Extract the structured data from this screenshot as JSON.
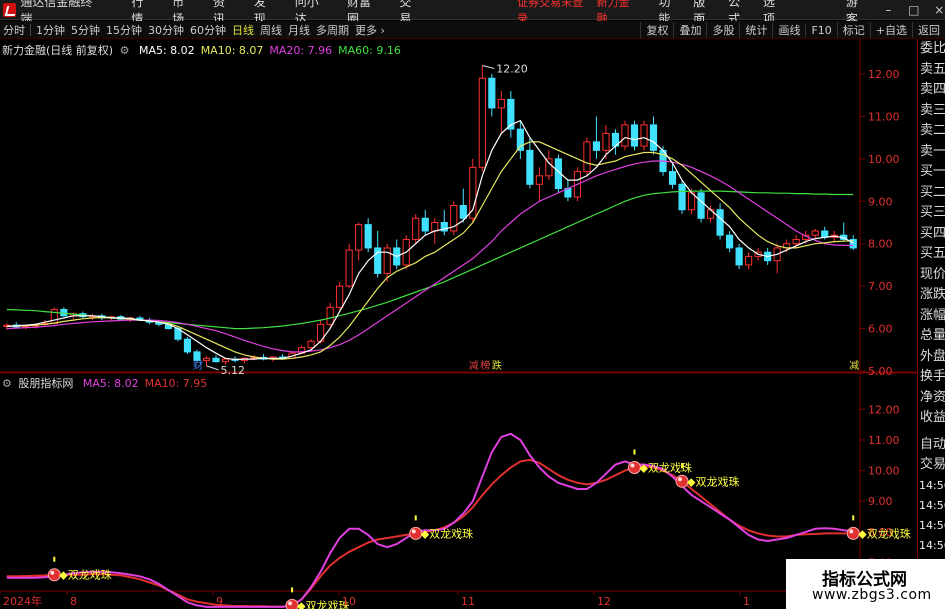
{
  "menubar": {
    "app_name": "通达信金融终端",
    "menus": [
      "行情",
      "市场",
      "资讯",
      "发现",
      "问小达",
      "财富圈",
      "交易"
    ],
    "warning": "证券交易未登录",
    "product": "新力金融",
    "right_menus": [
      "功能",
      "版面",
      "公式",
      "选项"
    ],
    "guest": "游客",
    "window_buttons": [
      "–",
      "□",
      "×"
    ]
  },
  "toolbar": {
    "periods": [
      "分时",
      "1分钟",
      "5分钟",
      "15分钟",
      "30分钟",
      "60分钟",
      "日线",
      "周线",
      "月线",
      "多周期",
      "更多"
    ],
    "active_period": "日线",
    "right_buttons": [
      "复权",
      "叠加",
      "多股",
      "统计",
      "画线",
      "F10",
      "标记",
      "+自选",
      "返回"
    ]
  },
  "main_chart": {
    "title": "新力金融(日线 前复权)",
    "ma_labels": [
      {
        "text": "MA5: 8.02",
        "color": "#ffffff"
      },
      {
        "text": "MA10: 8.07",
        "color": "#e8e860"
      },
      {
        "text": "MA20: 7.96",
        "color": "#e040e0"
      },
      {
        "text": "MA60: 9.16",
        "color": "#40e040"
      }
    ],
    "y_ticks": [
      "12.00",
      "11.00",
      "10.00",
      "9.00",
      "8.00",
      "7.00",
      "6.00",
      "5.00"
    ],
    "high_label": "12.20",
    "low_label": "5.12",
    "event_tags": [
      {
        "text": "财",
        "color": "#4a8cff"
      },
      {
        "text": "减",
        "color": "#e04040"
      },
      {
        "text": "榜",
        "color": "#e04040"
      },
      {
        "text": "跌",
        "color": "#e0e040"
      },
      {
        "text": "减",
        "color": "#e0e040"
      }
    ]
  },
  "sub_chart": {
    "title": "股朋指标网",
    "ma_labels": [
      {
        "text": "MA5: 8.02",
        "color": "#e040e0"
      },
      {
        "text": "MA10: 7.95",
        "color": "#e03030"
      }
    ],
    "y_ticks": [
      "12.00",
      "11.00",
      "10.00",
      "9.00",
      "8.00",
      "7.00"
    ],
    "signal_label": "双龙戏珠",
    "colors": {
      "ma5": "#e040e0",
      "ma10": "#e03030",
      "marker": "#e03030",
      "text": "#ffff40"
    }
  },
  "x_axis": {
    "labels": [
      "2024年",
      "8",
      "9",
      "10",
      "11",
      "12",
      "1"
    ]
  },
  "side_panel": {
    "items": [
      "委比",
      "卖五",
      "卖四",
      "卖三",
      "卖二",
      "卖一",
      "买一",
      "买二",
      "买三",
      "买四",
      "买五",
      "现价",
      "涨跌",
      "涨幅",
      "总量",
      "外盘",
      "换手",
      "净资",
      "收益"
    ],
    "items2": [
      "自动",
      "交易"
    ],
    "times": [
      "14:56",
      "14:56",
      "14:56",
      "14:56",
      "14:56",
      "14:56",
      "14:56",
      "14:56"
    ]
  },
  "watermark": {
    "title": "指标公式网",
    "url": "www.zbgs3.com"
  },
  "chart_data": [
    {
      "type": "candlestick",
      "title": "新力金融(日线 前复权)",
      "ylim": [
        5.0,
        12.4
      ],
      "up_color": "#ff3030",
      "down_color": "#40e0ff",
      "candles": [
        [
          6.05,
          6.12,
          5.98,
          6.08
        ],
        [
          6.08,
          6.15,
          6.0,
          6.04
        ],
        [
          6.04,
          6.1,
          5.98,
          6.06
        ],
        [
          6.06,
          6.12,
          6.0,
          6.1
        ],
        [
          6.1,
          6.2,
          6.05,
          6.12
        ],
        [
          6.12,
          6.5,
          6.1,
          6.45
        ],
        [
          6.45,
          6.5,
          6.28,
          6.3
        ],
        [
          6.3,
          6.38,
          6.22,
          6.35
        ],
        [
          6.35,
          6.4,
          6.25,
          6.28
        ],
        [
          6.28,
          6.35,
          6.2,
          6.3
        ],
        [
          6.3,
          6.35,
          6.2,
          6.25
        ],
        [
          6.25,
          6.3,
          6.18,
          6.28
        ],
        [
          6.28,
          6.32,
          6.2,
          6.22
        ],
        [
          6.22,
          6.28,
          6.15,
          6.25
        ],
        [
          6.25,
          6.3,
          6.18,
          6.2
        ],
        [
          6.2,
          6.25,
          6.1,
          6.15
        ],
        [
          6.15,
          6.2,
          6.05,
          6.1
        ],
        [
          6.1,
          6.15,
          5.98,
          6.0
        ],
        [
          6.0,
          6.05,
          5.7,
          5.75
        ],
        [
          5.75,
          5.8,
          5.4,
          5.45
        ],
        [
          5.45,
          5.5,
          5.2,
          5.25
        ],
        [
          5.25,
          5.35,
          5.12,
          5.3
        ],
        [
          5.3,
          5.38,
          5.2,
          5.22
        ],
        [
          5.22,
          5.3,
          5.15,
          5.28
        ],
        [
          5.28,
          5.35,
          5.2,
          5.25
        ],
        [
          5.25,
          5.32,
          5.18,
          5.3
        ],
        [
          5.3,
          5.38,
          5.25,
          5.32
        ],
        [
          5.32,
          5.4,
          5.25,
          5.28
        ],
        [
          5.28,
          5.35,
          5.22,
          5.33
        ],
        [
          5.33,
          5.4,
          5.28,
          5.3
        ],
        [
          5.3,
          5.45,
          5.28,
          5.42
        ],
        [
          5.42,
          5.6,
          5.4,
          5.55
        ],
        [
          5.55,
          5.75,
          5.5,
          5.7
        ],
        [
          5.7,
          6.2,
          5.65,
          6.1
        ],
        [
          6.1,
          6.6,
          6.05,
          6.5
        ],
        [
          6.5,
          7.1,
          6.45,
          7.0
        ],
        [
          7.0,
          8.0,
          6.95,
          7.85
        ],
        [
          7.85,
          8.5,
          7.6,
          8.45
        ],
        [
          8.45,
          8.6,
          7.8,
          7.9
        ],
        [
          7.9,
          8.3,
          7.2,
          7.3
        ],
        [
          7.3,
          8.0,
          7.1,
          7.9
        ],
        [
          7.9,
          8.1,
          7.4,
          7.5
        ],
        [
          7.5,
          8.2,
          7.4,
          8.1
        ],
        [
          8.1,
          8.7,
          8.0,
          8.6
        ],
        [
          8.6,
          8.8,
          8.2,
          8.3
        ],
        [
          8.3,
          8.6,
          8.0,
          8.5
        ],
        [
          8.5,
          8.8,
          8.2,
          8.3
        ],
        [
          8.3,
          9.0,
          8.2,
          8.9
        ],
        [
          8.9,
          9.3,
          8.5,
          8.6
        ],
        [
          8.6,
          10.0,
          8.5,
          9.8
        ],
        [
          9.8,
          12.2,
          9.7,
          11.9
        ],
        [
          11.9,
          12.0,
          11.0,
          11.2
        ],
        [
          11.2,
          11.6,
          10.6,
          11.4
        ],
        [
          11.4,
          11.6,
          10.5,
          10.7
        ],
        [
          10.7,
          10.9,
          10.0,
          10.2
        ],
        [
          10.2,
          10.5,
          9.3,
          9.4
        ],
        [
          9.4,
          9.8,
          9.0,
          9.6
        ],
        [
          9.6,
          10.2,
          9.5,
          10.0
        ],
        [
          10.0,
          10.1,
          9.2,
          9.3
        ],
        [
          9.3,
          9.5,
          9.0,
          9.1
        ],
        [
          9.1,
          9.8,
          9.0,
          9.7
        ],
        [
          9.7,
          10.5,
          9.6,
          10.4
        ],
        [
          10.4,
          11.0,
          10.0,
          10.2
        ],
        [
          10.2,
          10.8,
          10.0,
          10.6
        ],
        [
          10.6,
          10.7,
          10.1,
          10.3
        ],
        [
          10.3,
          10.9,
          10.2,
          10.8
        ],
        [
          10.8,
          10.9,
          10.2,
          10.3
        ],
        [
          10.3,
          10.9,
          10.2,
          10.8
        ],
        [
          10.8,
          11.0,
          10.1,
          10.2
        ],
        [
          10.2,
          10.3,
          9.6,
          9.7
        ],
        [
          9.7,
          9.9,
          9.3,
          9.4
        ],
        [
          9.4,
          9.5,
          8.7,
          8.8
        ],
        [
          8.8,
          9.3,
          8.7,
          9.2
        ],
        [
          9.2,
          9.3,
          8.5,
          8.6
        ],
        [
          8.6,
          8.9,
          8.5,
          8.8
        ],
        [
          8.8,
          8.95,
          8.1,
          8.2
        ],
        [
          8.2,
          8.3,
          7.8,
          7.9
        ],
        [
          7.9,
          8.0,
          7.4,
          7.5
        ],
        [
          7.5,
          7.8,
          7.4,
          7.7
        ],
        [
          7.7,
          7.9,
          7.6,
          7.8
        ],
        [
          7.8,
          7.9,
          7.5,
          7.6
        ],
        [
          7.6,
          8.0,
          7.3,
          7.9
        ],
        [
          7.9,
          8.1,
          7.8,
          8.0
        ],
        [
          8.0,
          8.2,
          7.9,
          8.1
        ],
        [
          8.1,
          8.3,
          8.0,
          8.2
        ],
        [
          8.2,
          8.35,
          8.1,
          8.3
        ],
        [
          8.3,
          8.4,
          8.1,
          8.15
        ],
        [
          8.15,
          8.3,
          8.05,
          8.2
        ],
        [
          8.2,
          8.5,
          8.05,
          8.1
        ],
        [
          8.1,
          8.2,
          7.85,
          7.9
        ]
      ],
      "ma5": [
        6.05,
        6.07,
        6.08,
        6.1,
        6.15,
        6.2,
        6.25,
        6.3,
        6.3,
        6.3,
        6.28,
        6.25,
        6.25,
        6.24,
        6.2,
        6.18,
        6.15,
        6.1,
        6.0,
        5.85,
        5.7,
        5.55,
        5.42,
        5.3,
        5.27,
        5.28,
        5.28,
        5.3,
        5.3,
        5.3,
        5.35,
        5.42,
        5.5,
        5.7,
        6.0,
        6.4,
        6.8,
        7.3,
        7.6,
        7.8,
        7.8,
        7.7,
        7.8,
        8.0,
        8.2,
        8.3,
        8.35,
        8.4,
        8.55,
        8.8,
        9.6,
        10.2,
        10.6,
        10.8,
        10.9,
        10.5,
        10.2,
        9.9,
        9.7,
        9.5,
        9.5,
        9.6,
        9.8,
        10.1,
        10.3,
        10.5,
        10.45,
        10.5,
        10.4,
        10.2,
        9.9,
        9.5,
        9.2,
        9.0,
        8.8,
        8.6,
        8.4,
        8.1,
        7.9,
        7.75,
        7.7,
        7.75,
        7.85,
        7.95,
        8.05,
        8.12,
        8.15,
        8.18,
        8.14,
        8.02
      ],
      "ma10": [
        6.05,
        6.06,
        6.07,
        6.08,
        6.1,
        6.13,
        6.17,
        6.2,
        6.23,
        6.25,
        6.26,
        6.25,
        6.24,
        6.22,
        6.2,
        6.18,
        6.15,
        6.12,
        6.05,
        5.95,
        5.85,
        5.75,
        5.65,
        5.55,
        5.45,
        5.38,
        5.33,
        5.3,
        5.28,
        5.28,
        5.3,
        5.33,
        5.38,
        5.45,
        5.6,
        5.8,
        6.05,
        6.35,
        6.65,
        6.95,
        7.2,
        7.35,
        7.45,
        7.55,
        7.7,
        7.8,
        7.95,
        8.1,
        8.25,
        8.5,
        8.9,
        9.3,
        9.7,
        10.0,
        10.3,
        10.4,
        10.4,
        10.3,
        10.2,
        10.1,
        10.0,
        9.9,
        9.85,
        9.9,
        9.95,
        10.05,
        10.1,
        10.15,
        10.15,
        10.1,
        10.0,
        9.85,
        9.65,
        9.45,
        9.25,
        9.05,
        8.85,
        8.6,
        8.4,
        8.2,
        8.05,
        7.95,
        7.9,
        7.9,
        7.95,
        8.0,
        8.02,
        8.05,
        8.06,
        8.07
      ],
      "ma20": [
        6.0,
        6.01,
        6.02,
        6.03,
        6.05,
        6.07,
        6.1,
        6.12,
        6.14,
        6.16,
        6.17,
        6.18,
        6.19,
        6.2,
        6.2,
        6.2,
        6.19,
        6.17,
        6.14,
        6.1,
        6.05,
        6.0,
        5.95,
        5.88,
        5.8,
        5.72,
        5.65,
        5.58,
        5.52,
        5.48,
        5.45,
        5.45,
        5.47,
        5.5,
        5.55,
        5.62,
        5.72,
        5.85,
        6.0,
        6.15,
        6.3,
        6.45,
        6.6,
        6.75,
        6.9,
        7.05,
        7.2,
        7.35,
        7.5,
        7.65,
        7.85,
        8.05,
        8.3,
        8.5,
        8.7,
        8.85,
        9.0,
        9.1,
        9.2,
        9.3,
        9.4,
        9.5,
        9.6,
        9.68,
        9.75,
        9.82,
        9.88,
        9.92,
        9.95,
        9.95,
        9.92,
        9.87,
        9.8,
        9.7,
        9.6,
        9.48,
        9.35,
        9.2,
        9.05,
        8.9,
        8.75,
        8.6,
        8.45,
        8.3,
        8.18,
        8.08,
        8.0,
        7.97,
        7.96,
        7.96
      ],
      "ma60": [
        6.45,
        6.44,
        6.43,
        6.42,
        6.4,
        6.38,
        6.36,
        6.34,
        6.32,
        6.3,
        6.28,
        6.26,
        6.24,
        6.22,
        6.2,
        6.18,
        6.16,
        6.14,
        6.12,
        6.1,
        6.08,
        6.06,
        6.04,
        6.02,
        6.0,
        6.0,
        6.01,
        6.02,
        6.04,
        6.06,
        6.09,
        6.12,
        6.16,
        6.2,
        6.25,
        6.3,
        6.36,
        6.42,
        6.48,
        6.55,
        6.62,
        6.7,
        6.78,
        6.86,
        6.94,
        7.02,
        7.1,
        7.2,
        7.3,
        7.4,
        7.5,
        7.6,
        7.7,
        7.8,
        7.9,
        8.0,
        8.1,
        8.2,
        8.3,
        8.4,
        8.5,
        8.6,
        8.7,
        8.8,
        8.9,
        9.0,
        9.08,
        9.14,
        9.18,
        9.2,
        9.22,
        9.23,
        9.24,
        9.24,
        9.24,
        9.24,
        9.23,
        9.22,
        9.21,
        9.2,
        9.2,
        9.19,
        9.19,
        9.18,
        9.18,
        9.17,
        9.17,
        9.16,
        9.16,
        9.16
      ]
    },
    {
      "type": "line",
      "title": "股朋指标网",
      "ylim": [
        6.2,
        12.5
      ],
      "series": [
        {
          "name": "MA5",
          "color": "#e040e0",
          "values": [
            6.5,
            6.5,
            6.5,
            6.5,
            6.52,
            6.55,
            6.6,
            6.65,
            6.68,
            6.7,
            6.7,
            6.68,
            6.65,
            6.6,
            6.55,
            6.45,
            6.3,
            6.1,
            5.9,
            5.7,
            5.6,
            5.55,
            5.55,
            5.55,
            5.55,
            5.55,
            5.55,
            5.55,
            5.55,
            5.55,
            5.6,
            5.8,
            6.2,
            6.7,
            7.3,
            7.8,
            8.1,
            8.1,
            7.9,
            7.6,
            7.5,
            7.6,
            7.8,
            8.0,
            8.05,
            8.05,
            8.1,
            8.3,
            8.6,
            9.0,
            9.8,
            10.6,
            11.1,
            11.2,
            11.0,
            10.5,
            10.1,
            9.8,
            9.6,
            9.5,
            9.4,
            9.4,
            9.6,
            9.9,
            10.2,
            10.3,
            10.2,
            10.2,
            10.15,
            10.05,
            9.8,
            9.5,
            9.2,
            9.0,
            8.8,
            8.6,
            8.4,
            8.15,
            7.9,
            7.75,
            7.7,
            7.75,
            7.8,
            7.9,
            8.0,
            8.1,
            8.12,
            8.1,
            8.05,
            8.02
          ]
        },
        {
          "name": "MA10",
          "color": "#e03030",
          "values": [
            6.55,
            6.55,
            6.56,
            6.57,
            6.58,
            6.6,
            6.6,
            6.6,
            6.6,
            6.62,
            6.62,
            6.6,
            6.58,
            6.52,
            6.45,
            6.35,
            6.25,
            6.1,
            5.95,
            5.8,
            5.72,
            5.67,
            5.62,
            5.6,
            5.58,
            5.58,
            5.57,
            5.57,
            5.56,
            5.56,
            5.6,
            5.8,
            6.15,
            6.55,
            6.9,
            7.15,
            7.35,
            7.5,
            7.65,
            7.75,
            7.8,
            7.85,
            7.9,
            7.95,
            8.0,
            8.05,
            8.15,
            8.3,
            8.5,
            8.8,
            9.2,
            9.55,
            9.85,
            10.1,
            10.3,
            10.35,
            10.25,
            10.05,
            9.85,
            9.7,
            9.6,
            9.55,
            9.6,
            9.7,
            9.85,
            10.0,
            10.1,
            10.15,
            10.1,
            10.0,
            9.85,
            9.65,
            9.4,
            9.15,
            8.9,
            8.65,
            8.4,
            8.2,
            8.05,
            7.95,
            7.88,
            7.85,
            7.85,
            7.9,
            7.92,
            7.93,
            7.95,
            7.95,
            7.95,
            7.95
          ]
        }
      ],
      "signals": [
        5,
        30,
        43,
        66,
        71,
        89
      ]
    }
  ]
}
